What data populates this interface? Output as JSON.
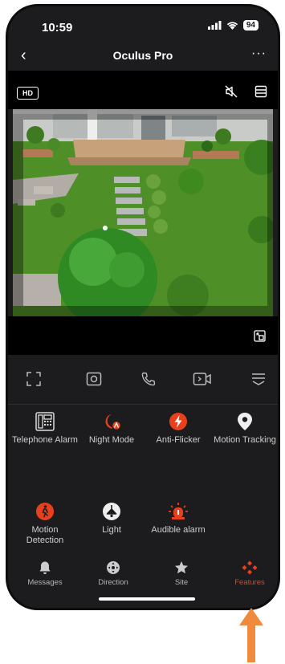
{
  "status_bar": {
    "time": "10:59",
    "battery": "94"
  },
  "nav": {
    "title": "Oculus Pro"
  },
  "video": {
    "quality_badge": "HD"
  },
  "features": [
    {
      "label": "Telephone Alarm",
      "icon": "phone-grid-icon",
      "active": false
    },
    {
      "label": "Night Mode",
      "icon": "night-mode-icon",
      "active": true
    },
    {
      "label": "Anti-Flicker",
      "icon": "lightning-icon",
      "active": true
    },
    {
      "label": "Motion Tracking",
      "icon": "location-pin-icon",
      "active": false
    },
    {
      "label": "Motion Detection",
      "icon": "running-person-icon",
      "active": true
    },
    {
      "label": "Light",
      "icon": "light-icon",
      "active": false
    },
    {
      "label": "Audible alarm",
      "icon": "siren-icon",
      "active": true
    }
  ],
  "tabs": [
    {
      "label": "Messages",
      "icon": "bell-icon"
    },
    {
      "label": "Direction",
      "icon": "direction-pad-icon"
    },
    {
      "label": "Site",
      "icon": "star-icon"
    },
    {
      "label": "Features",
      "icon": "features-icon",
      "selected": true
    }
  ],
  "colors": {
    "accent": "#e8401c",
    "background": "#1c1c1e",
    "arrow": "#f08a3c"
  }
}
